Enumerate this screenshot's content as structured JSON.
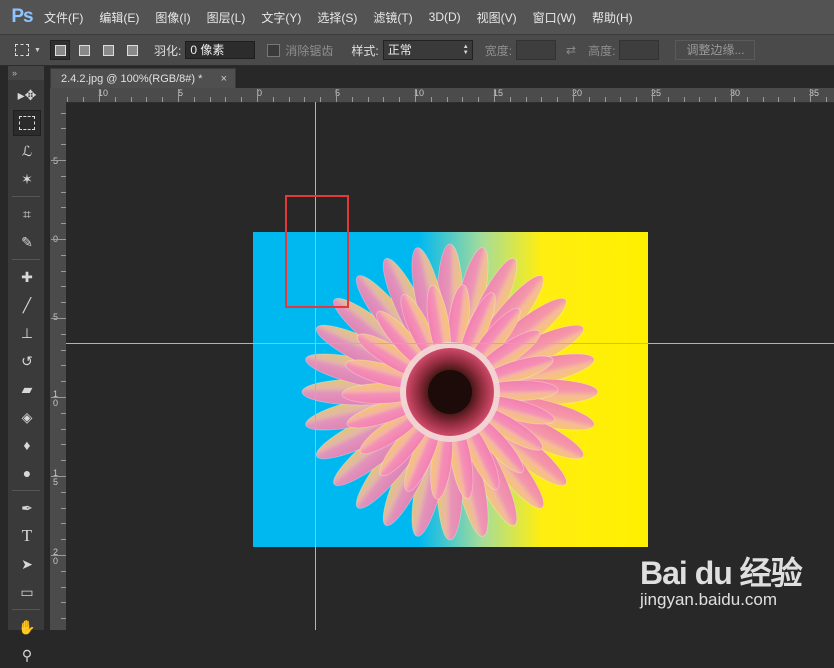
{
  "app": {
    "logo": "Ps"
  },
  "menu": [
    "文件(F)",
    "编辑(E)",
    "图像(I)",
    "图层(L)",
    "文字(Y)",
    "选择(S)",
    "滤镜(T)",
    "3D(D)",
    "视图(V)",
    "窗口(W)",
    "帮助(H)"
  ],
  "options": {
    "feather_label": "羽化:",
    "feather_value": "0 像素",
    "antialias_label": "消除锯齿",
    "style_label": "样式:",
    "style_value": "正常",
    "width_label": "宽度:",
    "height_label": "高度:",
    "refine_edge_label": "调整边缘..."
  },
  "document": {
    "tab_title": "2.4.2.jpg @ 100%(RGB/8#) *",
    "close": "×"
  },
  "ruler": {
    "top_labels": [
      "10",
      "5",
      "0",
      "5",
      "10",
      "15",
      "20",
      "25",
      "30",
      "35"
    ],
    "left_labels": [
      "5",
      "0",
      "5",
      "1\n0",
      "1\n5",
      "2\n0"
    ]
  },
  "toolbar": {
    "tools": [
      "move-tool",
      "rect-marquee-tool",
      "lasso-tool",
      "magic-wand-tool",
      "crop-tool",
      "eyedropper-tool",
      "healing-brush-tool",
      "brush-tool",
      "clone-stamp-tool",
      "history-brush-tool",
      "eraser-tool",
      "paint-bucket-tool",
      "blur-tool",
      "dodge-tool",
      "pen-tool",
      "type-tool",
      "path-selection-tool",
      "rectangle-tool",
      "hand-tool",
      "zoom-tool"
    ],
    "active_tool": "rect-marquee-tool"
  },
  "watermark": {
    "brand": "Bai du 经验",
    "url": "jingyan.baidu.com"
  }
}
